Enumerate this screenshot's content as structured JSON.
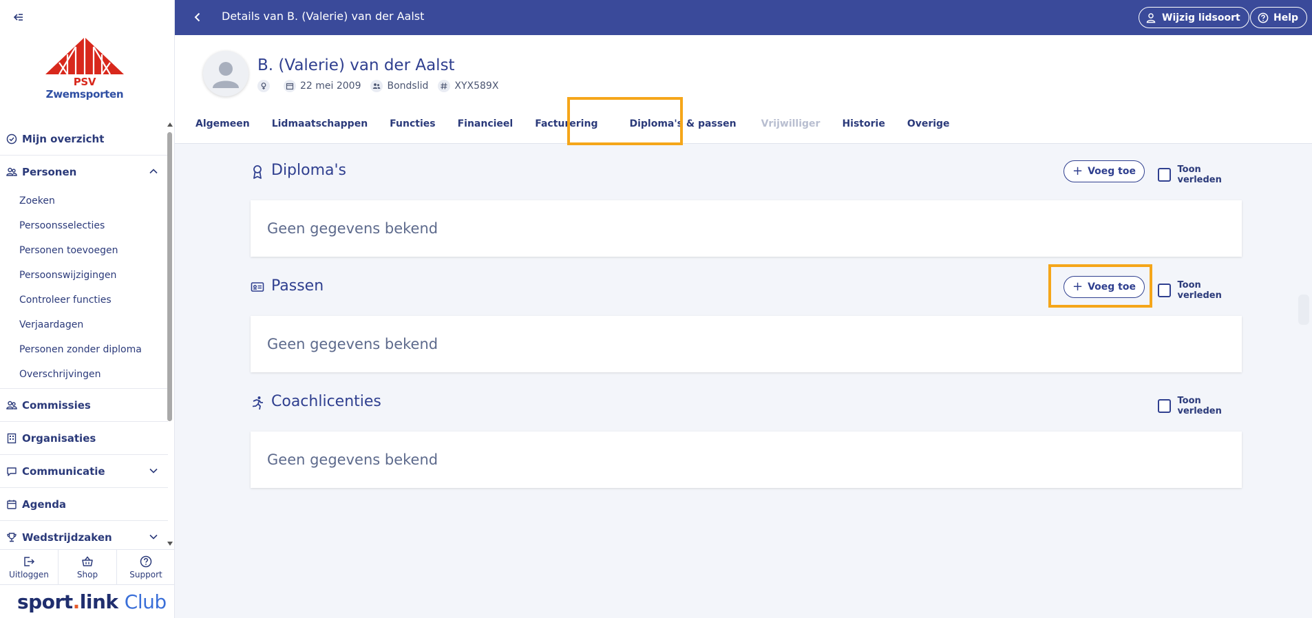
{
  "sidebar": {
    "logo": {
      "text_psv": "PSV",
      "text_name": "Zwemsporten",
      "alt": "PSV Zwemsporten logo"
    },
    "sections": {
      "overzicht": "Mijn overzicht",
      "personen": "Personen",
      "commissies": "Commissies",
      "organisaties": "Organisaties",
      "communicatie": "Communicatie",
      "agenda": "Agenda",
      "wedstrijdzaken": "Wedstrijdzaken"
    },
    "personen_items": [
      "Zoeken",
      "Persoonsselecties",
      "Personen toevoegen",
      "Persoonswijzigingen",
      "Controleer functies",
      "Verjaardagen",
      "Personen zonder diploma",
      "Overschrijvingen"
    ],
    "bottom": {
      "logout": "Uitloggen",
      "shop": "Shop",
      "support": "Support"
    },
    "brand": {
      "a": "sport",
      "dot": ".",
      "b": "link",
      "c": "Club"
    }
  },
  "topbar": {
    "title": "Details van B. (Valerie) van der Aalst",
    "lidsoort": "Wijzig lidsoort",
    "help": "Help"
  },
  "profile": {
    "name": "B. (Valerie) van der Aalst",
    "birthdate": "22 mei 2009",
    "member_type": "Bondslid",
    "relation_code": "XYX589X"
  },
  "tabs": [
    "Algemeen",
    "Lidmaatschappen",
    "Functies",
    "Financieel",
    "Facturering",
    "Diploma's & passen",
    "Vrijwilliger",
    "Historie",
    "Overige"
  ],
  "sections": {
    "diplomas": {
      "title": "Diploma's",
      "add": "Voeg toe",
      "past": "Toon verleden",
      "empty": "Geen gegevens bekend"
    },
    "passen": {
      "title": "Passen",
      "add": "Voeg toe",
      "past": "Toon verleden",
      "empty": "Geen gegevens bekend"
    },
    "coach": {
      "title": "Coachlicenties",
      "past": "Toon verleden",
      "empty": "Geen gegevens bekend"
    }
  },
  "colors": {
    "topbar": "#3a4a9a",
    "text_primary": "#2b3a7a",
    "highlight": "#f5a61a",
    "logo_red": "#d8281c",
    "logo_blue": "#2f4fa3"
  }
}
